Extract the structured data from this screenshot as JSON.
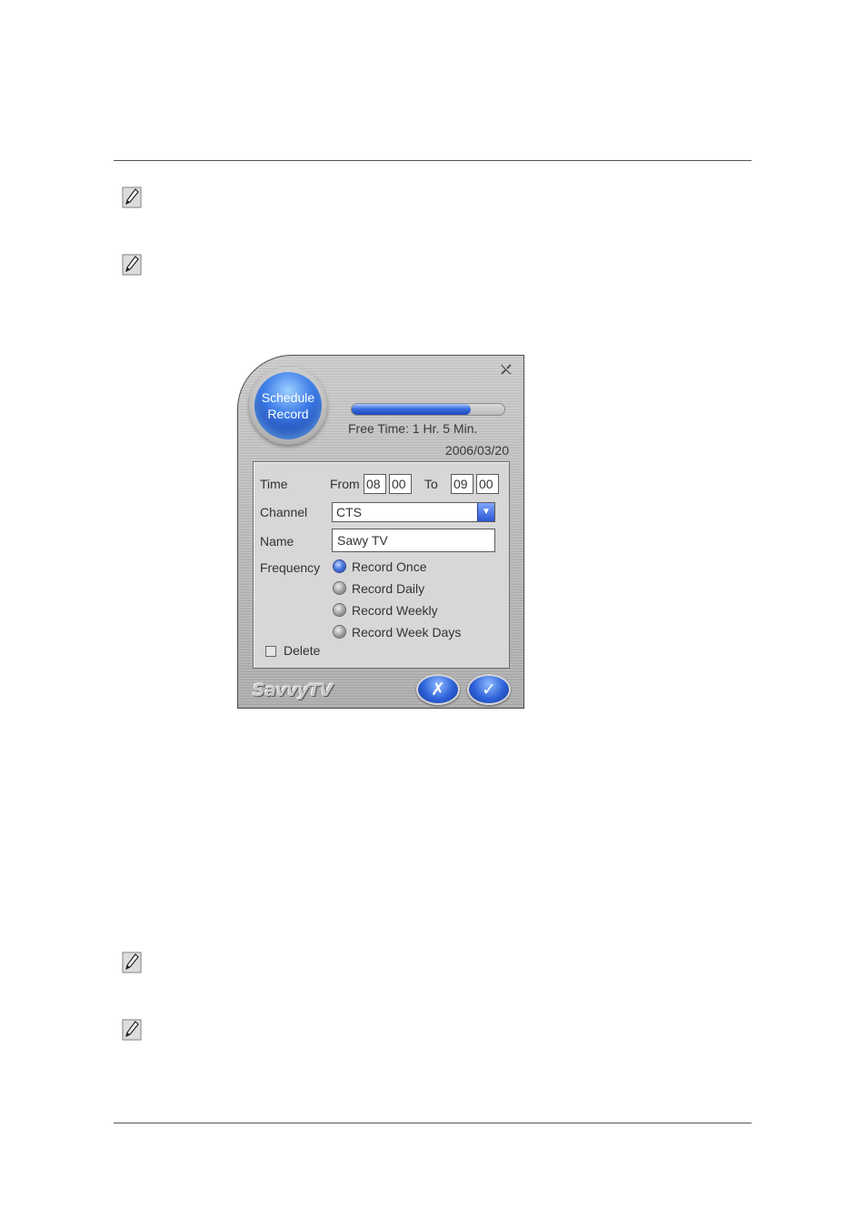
{
  "dialog": {
    "orb": {
      "line1": "Schedule",
      "line2": "Record"
    },
    "progress_fraction": 0.78,
    "free_time": "Free Time: 1 Hr. 5 Min.",
    "date": "2006/03/20",
    "form": {
      "time_label": "Time",
      "from_label": "From",
      "from_hour": "08",
      "from_min": "00",
      "to_label": "To",
      "to_hour": "09",
      "to_min": "00",
      "channel_label": "Channel",
      "channel_value": "CTS",
      "name_label": "Name",
      "name_value": "Sawy TV",
      "frequency_label": "Frequency",
      "frequency_options": [
        "Record Once",
        "Record Daily",
        "Record Weekly",
        "Record Week Days"
      ],
      "frequency_selected": "Record Once",
      "delete_label": "Delete"
    },
    "brand": "SavvyTV",
    "icons": {
      "close": "close-icon",
      "cancel": "x-icon",
      "ok": "checkmark-icon",
      "note": "pencil-note-icon"
    }
  }
}
